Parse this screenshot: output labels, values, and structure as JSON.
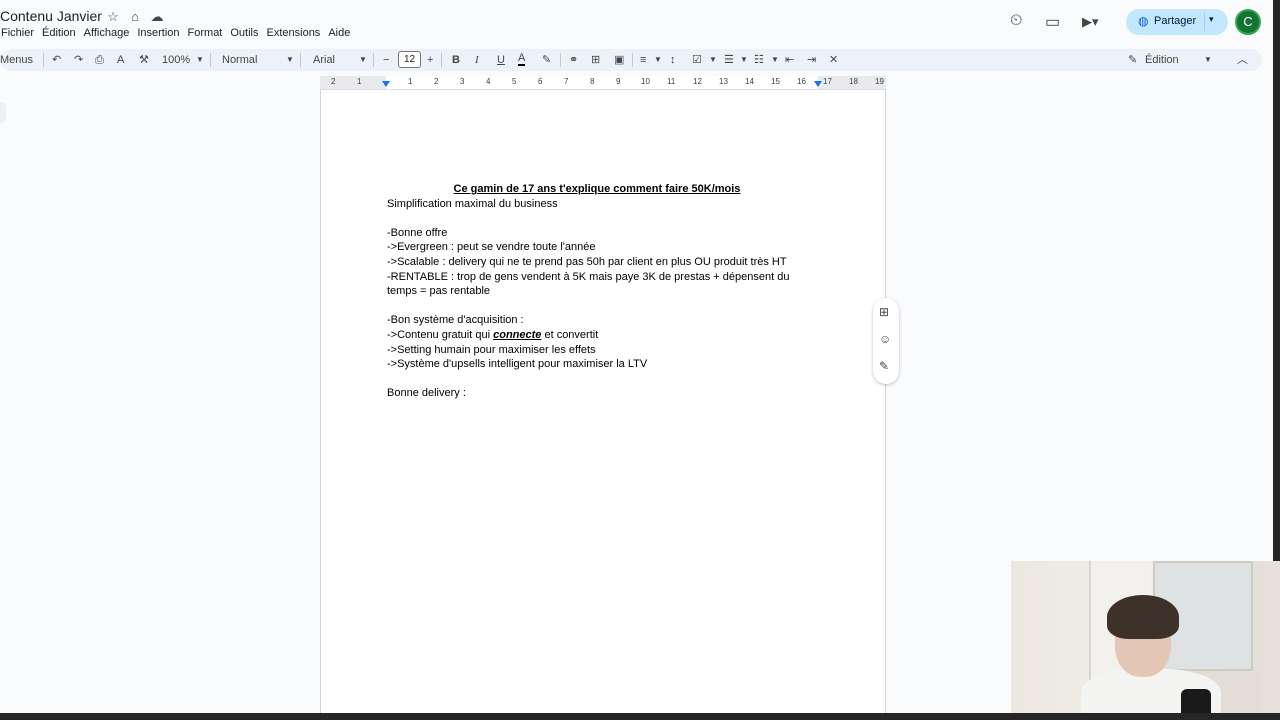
{
  "document": {
    "title": "Contenu Janvier"
  },
  "menu": [
    "Fichier",
    "Édition",
    "Affichage",
    "Insertion",
    "Format",
    "Outils",
    "Extensions",
    "Aide"
  ],
  "header": {
    "share_label": "Partager",
    "avatar_letter": "C"
  },
  "toolbar": {
    "menus_label": "Menus",
    "zoom": "100%",
    "style": "Normal",
    "font": "Arial",
    "font_size": "12",
    "mode_label": "Édition"
  },
  "ruler": [
    "2",
    "1",
    "1",
    "2",
    "3",
    "4",
    "5",
    "6",
    "7",
    "8",
    "9",
    "10",
    "11",
    "12",
    "13",
    "14",
    "15",
    "16",
    "17",
    "18",
    "19"
  ],
  "content": {
    "heading": "Ce gamin de 17 ans t'explique comment faire 50K/mois",
    "subtitle": "Simplification maximal du business",
    "offer_title": "-Bonne offre",
    "offer_1": "->Evergreen : peut se vendre toute l'année",
    "offer_2": "->Scalable : delivery qui ne te prend pas 50h par client en plus OU produit très HT",
    "offer_3": "-RENTABLE : trop de gens vendent à 5K mais paye 3K de prestas + dépensent du temps = pas rentable",
    "acq_title": "-Bon système d'acquisition :",
    "acq_1_pre": "->Contenu gratuit qui ",
    "acq_1_emph": "connecte",
    "acq_1_post": " et convertit",
    "acq_2": "->Setting humain pour maximiser les effets",
    "acq_3": "->Système d'upsells intelligent pour maximiser la LTV",
    "delivery_title": "Bonne delivery :"
  },
  "colors": {
    "accent": "#1a73e8",
    "share_bg": "#c2e7ff",
    "toolbar_bg": "#edf2fa",
    "avatar_bg": "#137333"
  }
}
